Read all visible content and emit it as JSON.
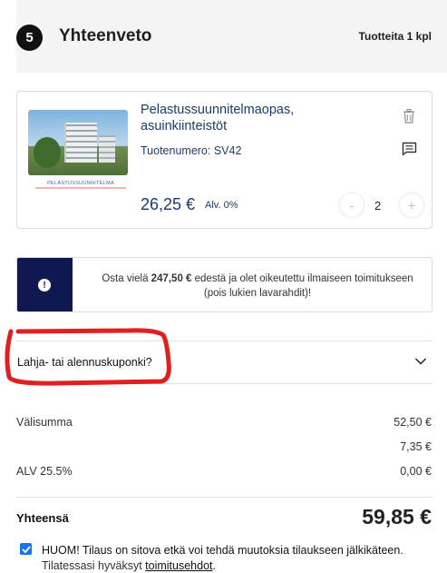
{
  "header": {
    "step_number": "5",
    "title": "Yhteenveto",
    "item_count": "Tuotteita 1 kpl"
  },
  "product": {
    "name": "Pelastussuunnitelmaopas, asuinkiinteistöt",
    "code": "Tuotenumero: SV42",
    "price": "26,25 €",
    "vat": "Alv. 0%",
    "quantity": "2",
    "minus_label": "-",
    "plus_label": "+",
    "thumbnail_caption": "PELASTUSSUUNNITELMA",
    "icons": {
      "delete": "trash-icon",
      "comment": "comment-icon"
    }
  },
  "notice": {
    "badge": "!",
    "text_before": "Osta vielä ",
    "amount": "247,50 €",
    "text_after": " edestä ja olet oikeutettu ilmaiseen toimitukseen (pois lukien lavarahdit)!"
  },
  "coupon": {
    "label": "Lahja- tai alennuskuponki?"
  },
  "summary": {
    "subtotal_label": "Välisumma",
    "subtotal_value": "52,50 €",
    "shipping_value": "7,35 €",
    "vat_label": "ALV 25.5%",
    "vat_value": "0,00 €",
    "total_label": "Yhteensä",
    "total_value": "59,85 €"
  },
  "terms": {
    "checked": true,
    "text": "HUOM! Tilaus on sitova etkä voi tehdä muutoksia tilaukseen jälkikäteen.",
    "sub_text": " Tilatessasi hyväksyt ",
    "link_text": "toimitusehdot",
    "end_text": "."
  },
  "colors": {
    "accent_navy": "#101852",
    "product_text": "#1a3c73",
    "highlight_red": "#e02020",
    "checkbox_blue": "#1a73e8"
  }
}
